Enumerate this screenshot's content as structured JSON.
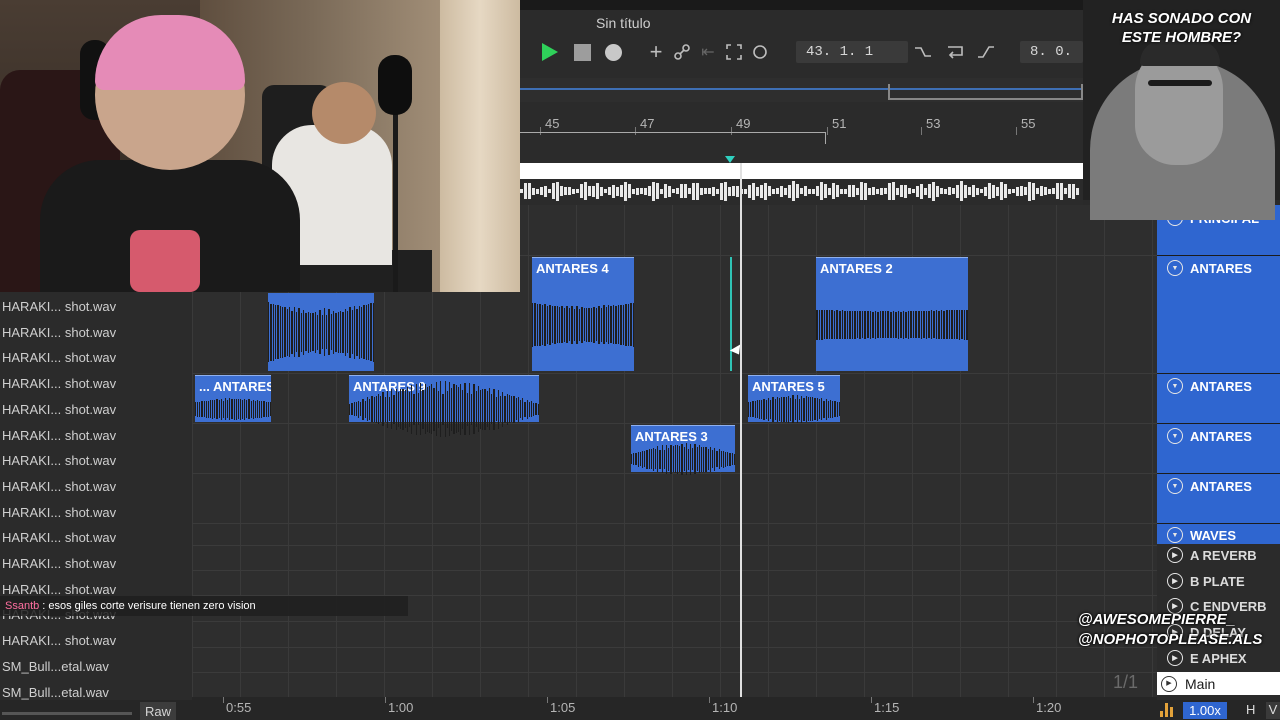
{
  "song_title": "Sin título",
  "transport": {
    "position": "43.   1.   1",
    "tempo_field": "8.  0."
  },
  "bar_numbers": [
    "45",
    "47",
    "49",
    "51",
    "53",
    "55"
  ],
  "tracks": [
    "HARAKI... shot.wav",
    "HARAKI... shot.wav",
    "HARAKI... shot.wav",
    "HARAKI... shot.wav",
    "HARAKI... shot.wav",
    "HARAKI... shot.wav",
    "HARAKI... shot.wav",
    "HARAKI... shot.wav",
    "HARAKI... shot.wav",
    "HARAKI... shot.wav",
    "HARAKI... shot.wav",
    "HARAKI... shot.wav",
    "HARAKI... shot.wav",
    "HARAKI... shot.wav",
    "SM_Bull...etal.wav",
    "SM_Bull...etal.wav"
  ],
  "clips": {
    "antares4": "ANTARES 4",
    "antares2": "ANTARES 2",
    "antares_partial": "... ANTARES",
    "antares9": "ANTARES 9",
    "antares5": "ANTARES 5",
    "antares3": "ANTARES 3"
  },
  "time_labels": [
    "0:55",
    "1:00",
    "1:05",
    "1:10",
    "1:15",
    "1:20"
  ],
  "bottom_left": {
    "raw_label": "Raw"
  },
  "chat": {
    "user": "Ssantb",
    "message": ": esos giles corte verisure tienen zero vision"
  },
  "right_panel": {
    "principal": "PRINCIPAL",
    "antares": [
      "ANTARES",
      "ANTARES",
      "ANTARES",
      "ANTARES"
    ],
    "waves": "WAVES",
    "returns": [
      "A REVERB",
      "B PLATE",
      "C ENDVERB",
      "D DELAY",
      "E APHEX"
    ],
    "main": "Main",
    "page": "1/1"
  },
  "bottom_right": {
    "zoom": "1.00x",
    "h": "H",
    "v": "V"
  },
  "overlay": {
    "facecam_caption_1": "HAS SONADO CON",
    "facecam_caption_2": "ESTE HOMBRE?",
    "social_1": "@AWESOMEPIERRE_",
    "social_2": "@NOPHOTOPLEASE.ALS"
  },
  "colors": {
    "clip_blue": "#3d6fd2",
    "play_green": "#2fd15a",
    "playhead_cursor": "#2fc3b5",
    "chat_user": "#ff6fa0"
  }
}
